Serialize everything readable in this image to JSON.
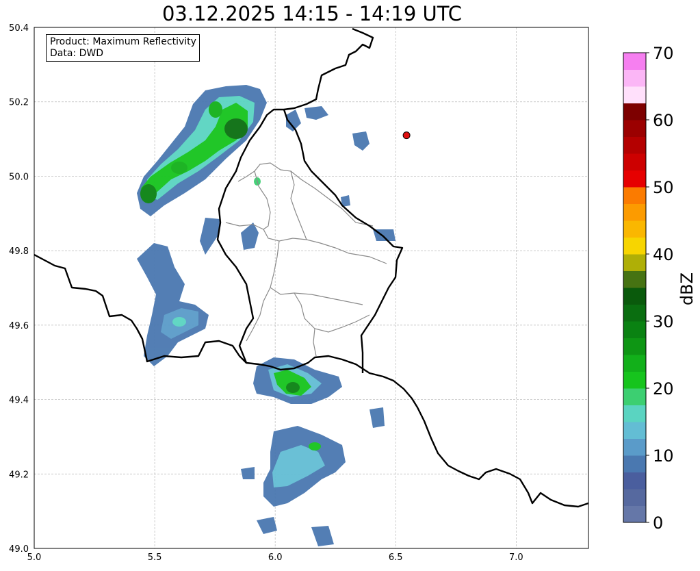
{
  "title": "03.12.2025 14:15 - 14:19 UTC",
  "info": {
    "product": "Product: Maximum Reflectivity",
    "source": "Data: DWD"
  },
  "axes": {
    "x_ticks": [
      "5.0",
      "5.5",
      "6.0",
      "6.5",
      "7.0"
    ],
    "y_ticks": [
      "49.0",
      "49.2",
      "49.4",
      "49.6",
      "49.8",
      "50.0",
      "50.2",
      "50.4"
    ],
    "lon_range": [
      5.0,
      7.3
    ],
    "lat_range": [
      49.0,
      50.4
    ],
    "grid": true
  },
  "colorbar": {
    "label": "dBZ",
    "ticks": [
      "0",
      "10",
      "20",
      "30",
      "40",
      "50",
      "60",
      "70"
    ],
    "range": [
      0,
      70
    ],
    "step": 2.5,
    "colors": [
      "#6577a8",
      "#56699f",
      "#4a5e9e",
      "#4a78b0",
      "#5a9bc9",
      "#63bdd4",
      "#5ad4c1",
      "#3ccf71",
      "#16c41d",
      "#12b01a",
      "#0e9614",
      "#0a8212",
      "#0a6e10",
      "#0a5a0c",
      "#467312",
      "#afaf06",
      "#f7d500",
      "#fab700",
      "#fc9b00",
      "#fb7b00",
      "#e60000",
      "#cd0000",
      "#b40000",
      "#9b0000",
      "#7d0000",
      "#ffe0fb",
      "#fbb6f6",
      "#f67ff0",
      "#ef3ff0"
    ]
  },
  "marker": {
    "lon": 6.545,
    "lat": 50.11,
    "color": "#e01010"
  }
}
